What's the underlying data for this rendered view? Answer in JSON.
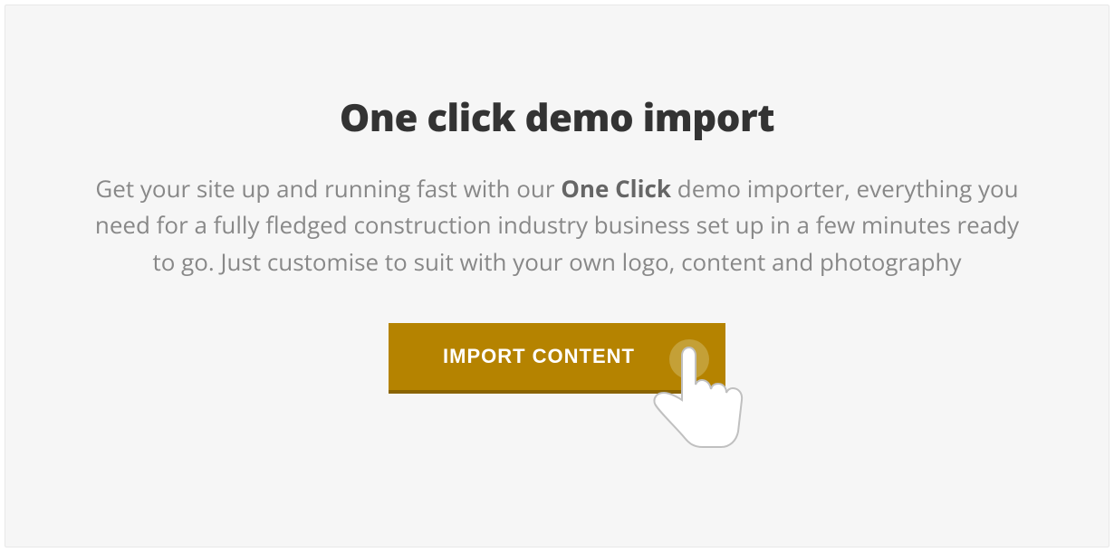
{
  "heading": "One click demo import",
  "description": {
    "part1": "Get your site up and running fast with our ",
    "bold": "One Click",
    "part2": " demo importer, everything you need for a fully fledged construction industry business set up in a few minutes ready to go. Just customise to suit with your own logo, content and photography"
  },
  "button_label": "IMPORT CONTENT",
  "colors": {
    "background": "#f6f6f6",
    "heading": "#333333",
    "text": "#888888",
    "button_bg": "#b58300",
    "button_shadow": "#8a6400",
    "button_text": "#ffffff"
  }
}
